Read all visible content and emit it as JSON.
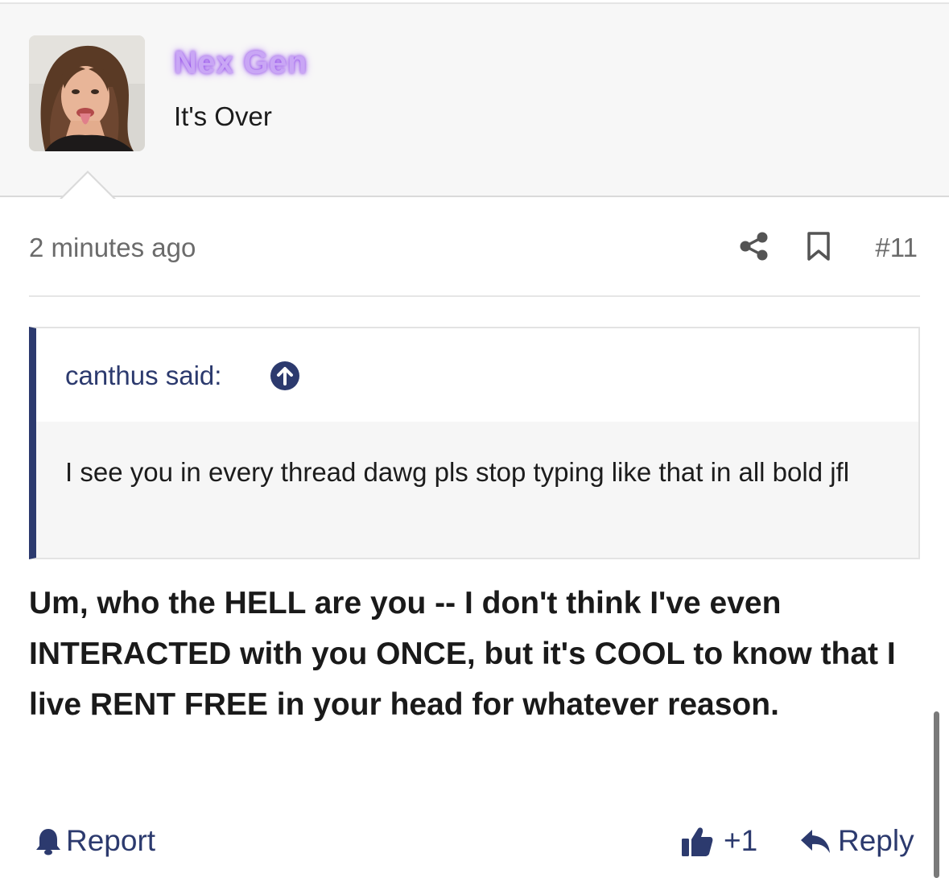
{
  "user": {
    "name": "Nex Gen",
    "title": "It's Over",
    "avatar_icon": "user-avatar-photo",
    "name_color": "#c9a6f5"
  },
  "meta": {
    "time": "2 minutes ago",
    "share_icon": "share-icon",
    "bookmark_icon": "bookmark-icon",
    "post_number": "#11"
  },
  "quote": {
    "author": "canthus said:",
    "jump_icon": "arrow-up-circle-icon",
    "text": "I see you in every thread dawg pls stop typing like that in all bold jfl",
    "accent_color": "#2c3a6e"
  },
  "message": {
    "text": "Um, who the HELL are you -- I don't think I've even INTERACTED with you ONCE, but it's COOL to know that I live RENT FREE in your head for whatever reason."
  },
  "actions": {
    "report_label": "Report",
    "report_icon": "bell-icon",
    "like_count": "+1",
    "like_icon": "thumbs-up-icon",
    "reply_label": "Reply",
    "reply_icon": "reply-arrow-icon",
    "link_color": "#2c3a6e"
  }
}
